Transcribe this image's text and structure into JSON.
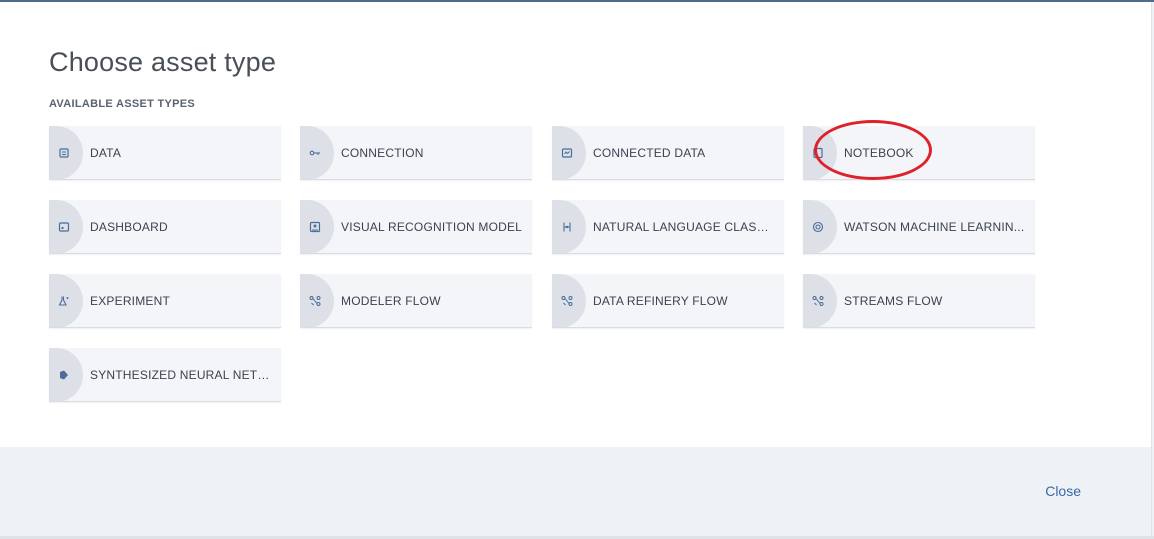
{
  "dialog": {
    "title": "Choose asset type",
    "subtitle": "AVAILABLE ASSET TYPES",
    "close_label": "Close"
  },
  "tiles": [
    {
      "label": "DATA",
      "icon": "data-icon"
    },
    {
      "label": "CONNECTION",
      "icon": "connection-icon"
    },
    {
      "label": "CONNECTED DATA",
      "icon": "connected-data-icon"
    },
    {
      "label": "NOTEBOOK",
      "icon": "notebook-icon"
    },
    {
      "label": "DASHBOARD",
      "icon": "dashboard-icon"
    },
    {
      "label": "VISUAL RECOGNITION MODEL",
      "icon": "visual-recognition-icon"
    },
    {
      "label": "NATURAL LANGUAGE CLASSIF...",
      "icon": "natural-language-icon"
    },
    {
      "label": "WATSON MACHINE LEARNIN...",
      "icon": "machine-learning-icon"
    },
    {
      "label": "EXPERIMENT",
      "icon": "experiment-icon"
    },
    {
      "label": "MODELER FLOW",
      "icon": "modeler-flow-icon"
    },
    {
      "label": "DATA REFINERY FLOW",
      "icon": "data-refinery-flow-icon"
    },
    {
      "label": "STREAMS FLOW",
      "icon": "streams-flow-icon"
    },
    {
      "label": "SYNTHESIZED NEURAL NETW...",
      "icon": "neural-network-icon"
    }
  ],
  "colors": {
    "accent": "#3a6aa8",
    "tile_bg": "#f3f5f8",
    "footer_bg": "#eef1f5",
    "annotation": "#e0202a"
  }
}
